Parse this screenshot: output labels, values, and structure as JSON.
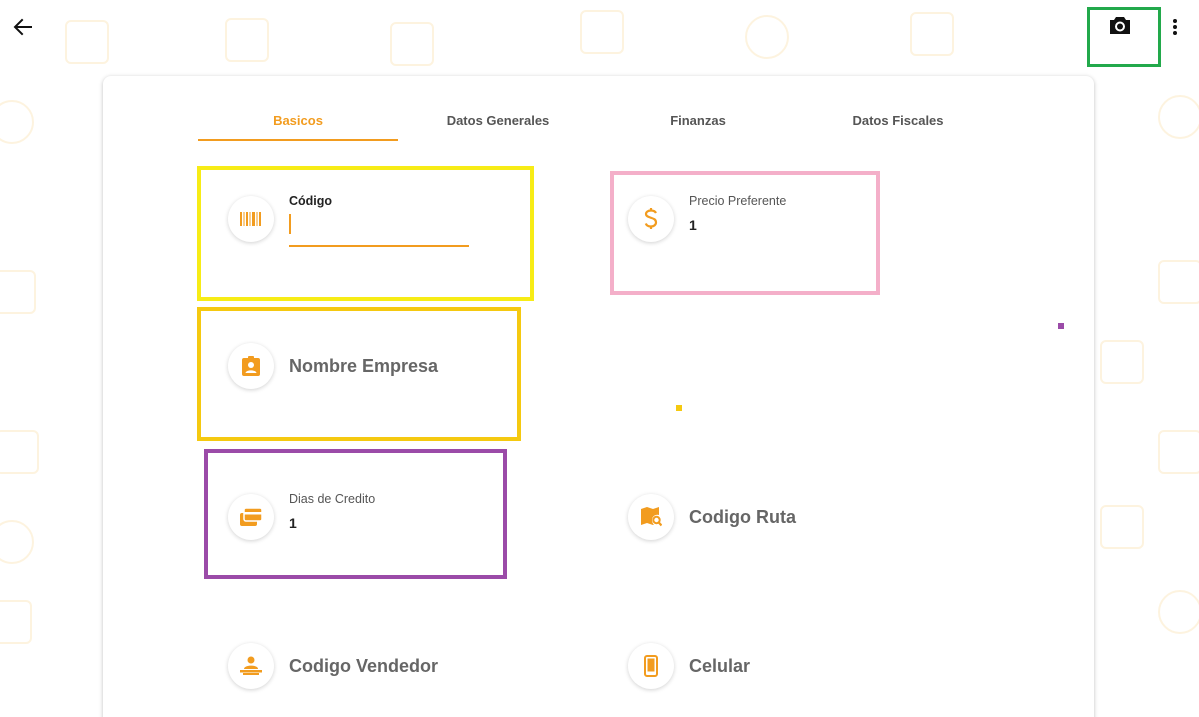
{
  "colors": {
    "accent": "#f29c1f",
    "camera_box": "#22a94b",
    "box_yellow": "#f7ec16",
    "box_gold": "#f5c910",
    "box_pink": "#f4afc9",
    "box_purple": "#9b4ba8",
    "tab_text": "#555555"
  },
  "toolbar": {
    "back_icon": "arrow-left-icon",
    "camera_icon": "camera-icon",
    "more_icon": "more-vert-icon"
  },
  "tabs": [
    {
      "label": "Basicos",
      "active": true
    },
    {
      "label": "Datos Generales",
      "active": false
    },
    {
      "label": "Finanzas",
      "active": false
    },
    {
      "label": "Datos Fiscales",
      "active": false
    }
  ],
  "fields": {
    "codigo": {
      "label": "Código",
      "value": "",
      "icon": "barcode-icon"
    },
    "precio_preferente": {
      "label": "Precio Preferente",
      "value": "1",
      "icon": "dollar-icon"
    },
    "nombre_empresa": {
      "label": "Nombre Empresa",
      "icon": "badge-icon"
    },
    "dias_credito": {
      "label": "Dias de Credito",
      "value": "1",
      "icon": "cards-icon"
    },
    "codigo_ruta": {
      "label": "Codigo Ruta",
      "icon": "map-search-icon"
    },
    "codigo_vendedor": {
      "label": "Codigo Vendedor",
      "icon": "seller-icon"
    },
    "celular": {
      "label": "Celular",
      "icon": "phone-icon"
    }
  }
}
